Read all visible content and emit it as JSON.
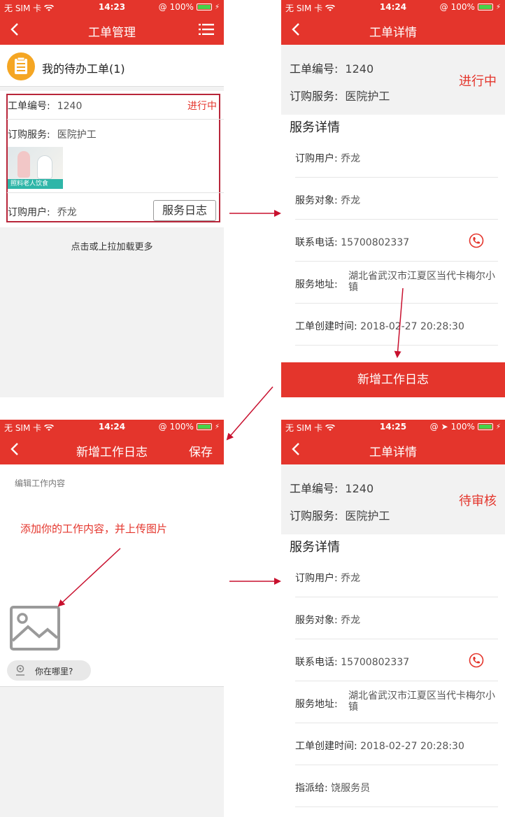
{
  "status_bar": {
    "carrier": "无 SIM 卡",
    "battery": "100%",
    "times": [
      "14:23",
      "14:24",
      "14:24",
      "14:25"
    ]
  },
  "panel1": {
    "nav_title": "工单管理",
    "pending_title": "我的待办工单(1)",
    "order": {
      "id_label": "工单编号:",
      "id_value": "1240",
      "status": "进行中",
      "service_label": "订购服务:",
      "service_value": "医院护工",
      "image_caption": "照料老人饮食",
      "user_label": "订购用户:",
      "user_value": "乔龙",
      "log_button": "服务日志"
    },
    "load_more": "点击或上拉加载更多"
  },
  "panel2": {
    "nav_title": "工单详情",
    "id_label": "工单编号:",
    "id_value": "1240",
    "service_label": "订购服务:",
    "service_value": "医院护工",
    "status": "进行中",
    "section_title": "服务详情",
    "user_label": "订购用户:",
    "user_value": "乔龙",
    "target_label": "服务对象:",
    "target_value": "乔龙",
    "phone_label": "联系电话:",
    "phone_value": "15700802337",
    "address_label": "服务地址:",
    "address_value": "湖北省武汉市江夏区当代卡梅尔小镇",
    "created_label": "工单创建时间:",
    "created_value": "2018-02-27 20:28:30",
    "new_log_button": "新增工作日志"
  },
  "panel3": {
    "nav_title": "新增工作日志",
    "save_label": "保存",
    "editor_placeholder": "编辑工作内容",
    "location_label": "你在哪里?"
  },
  "panel4": {
    "nav_title": "工单详情",
    "id_label": "工单编号:",
    "id_value": "1240",
    "service_label": "订购服务:",
    "service_value": "医院护工",
    "status": "待审核",
    "section_title": "服务详情",
    "user_label": "订购用户:",
    "user_value": "乔龙",
    "target_label": "服务对象:",
    "target_value": "乔龙",
    "phone_label": "联系电话:",
    "phone_value": "15700802337",
    "address_label": "服务地址:",
    "address_value": "湖北省武汉市江夏区当代卡梅尔小镇",
    "created_label": "工单创建时间:",
    "created_value": "2018-02-27 20:28:30",
    "assigned_label": "指派给:",
    "assigned_value": "饶服务员"
  },
  "annotation": "添加你的工作内容，并上传图片",
  "colors": {
    "brand_red": "#e4352c",
    "frame_red": "#b8263a",
    "annotation_red": "#c8102e",
    "pending_icon": "#f5a623"
  }
}
